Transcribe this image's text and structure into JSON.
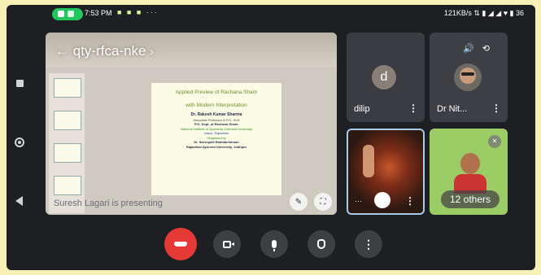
{
  "status_bar": {
    "time": "7:53 PM",
    "notification_dots": "■ ■ ■ ···",
    "right_info": "121KB/s ⇅ ▮ ◢ ◢ ♥ ▮ 36",
    "accent_color": "#22c55e"
  },
  "meeting": {
    "code": "qty-rfca-nke",
    "presenting_text": "Suresh Lagari is presenting"
  },
  "slide": {
    "title_line1": "Applied Preview of Rachana Sharir",
    "title_line2": "with Modern Interpretation",
    "presenter": "Dr. Rakesh Kumar Sharma",
    "lines": [
      "Associate Professor & P.G. HoD",
      "P.G. Dept. of Rachana Sharir",
      "National Institute of Ayurveda, Deemed University",
      "Jaipur, Rajasthan",
      "Organised by",
      "Dr. Sarvepalli Radhakrishnan",
      "Rajasthan Ayurved University, Jodhpur"
    ]
  },
  "participants": [
    {
      "name": "dilip",
      "avatar_letter": "d",
      "avatar_color": "#8a7f77"
    },
    {
      "name": "Dr Nit...",
      "avatar_color": "#6d6a64"
    }
  ],
  "others_label": "12 others",
  "icons": {
    "volume": "speaker-icon",
    "switch_camera": "switch-camera-icon",
    "end_call": "end-call-icon",
    "camera": "camera-icon",
    "microphone": "microphone-icon",
    "raise_hand": "raise-hand-icon",
    "more": "more-options-icon"
  },
  "colors": {
    "end_call": "#e53935",
    "others_tile": "#9ccc65",
    "background": "#1d1f22"
  }
}
